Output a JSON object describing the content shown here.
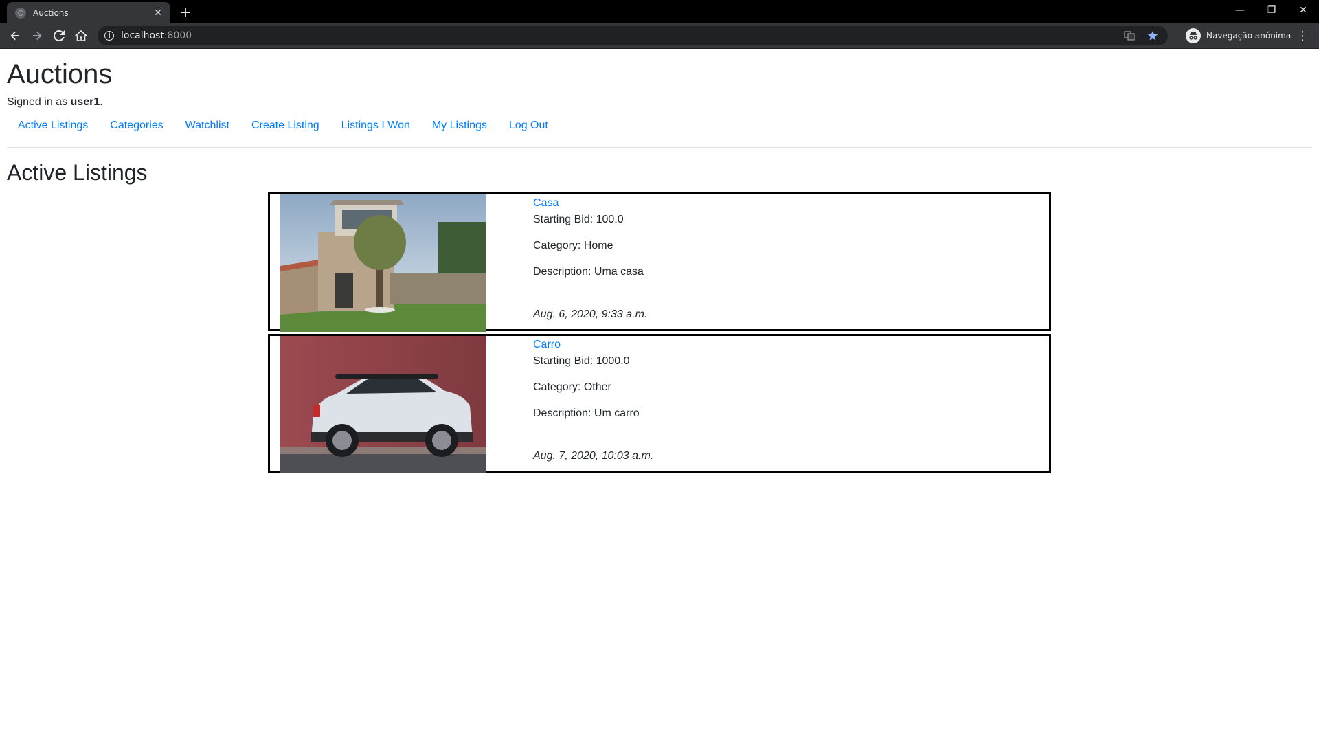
{
  "browser": {
    "tab_title": "Auctions",
    "url_host": "localhost",
    "url_port": ":8000",
    "profile_label": "Navegação anónima",
    "icons": [
      "back-icon",
      "forward-icon",
      "reload-icon",
      "home-icon",
      "info-icon",
      "translate-icon",
      "star-icon",
      "incognito-icon",
      "menu-icon"
    ]
  },
  "header": {
    "title": "Auctions",
    "signed_in_prefix": "Signed in as ",
    "username": "user1",
    "signed_in_suffix": "."
  },
  "nav": [
    "Active Listings",
    "Categories",
    "Watchlist",
    "Create Listing",
    "Listings I Won",
    "My Listings",
    "Log Out"
  ],
  "main": {
    "heading": "Active Listings",
    "listings": [
      {
        "title": "Casa",
        "starting_bid": "Starting Bid: 100.0",
        "category": "Category: Home",
        "description": "Description: Uma casa",
        "date": "Aug. 6, 2020, 9:33 a.m."
      },
      {
        "title": "Carro",
        "starting_bid": "Starting Bid: 1000.0",
        "category": "Category: Other",
        "description": "Description: Um carro",
        "date": "Aug. 7, 2020, 10:03 a.m."
      }
    ]
  },
  "colors": {
    "link": "#007bff",
    "text": "#212529",
    "chrome_dark": "#35363a"
  }
}
